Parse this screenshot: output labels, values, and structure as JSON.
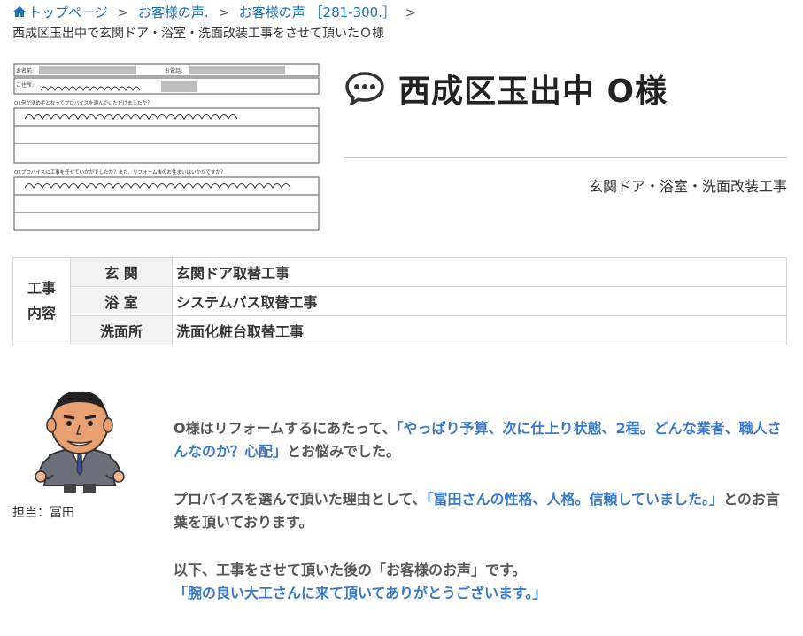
{
  "breadcrumb": {
    "items": [
      {
        "label": "トップページ",
        "icon": "home-icon"
      },
      {
        "label": "お客様の声."
      },
      {
        "label": "お客様の声 ［281-300.］"
      }
    ],
    "separator": ">",
    "current": "西成区玉出中で玄関ドア・浴室・洗面改装工事をさせて頂いたＯ様"
  },
  "title": {
    "icon": "chat-bubble-icon",
    "text": "西成区玉出中 O様"
  },
  "subtitle": "玄関ドア・浴室・洗面改装工事",
  "work_table": {
    "header": [
      "工事",
      "内容"
    ],
    "rows": [
      {
        "category": "玄 関",
        "detail": "玄関ドア取替工事"
      },
      {
        "category": "浴 室",
        "detail": "システムバス取替工事"
      },
      {
        "category": "洗面所",
        "detail": "洗面化粧台取替工事"
      }
    ]
  },
  "staff": {
    "label": "担当：冨田"
  },
  "comment": {
    "p1_pre": "O様はリフォームするにあたって、",
    "p1_hl": "「やっぱり予算、次に仕上り状態、2程。どんな業者、職人さんなのか？心配」",
    "p1_post": "とお悩みでした。",
    "p2_pre": "プロバイスを選んで頂いた理由として、",
    "p2_hl": "「冨田さんの性格、人格。信頼していました。」",
    "p2_post": "とのお言葉を頂いております。",
    "p3_line": "以下、工事をさせて頂いた後の「お客様のお声」です。",
    "p3_hl": "「腕の良い大工さんに来て頂いてありがとうございます。」"
  },
  "colors": {
    "link": "#1a6fb5",
    "highlight": "#3a78c9",
    "table_border": "#d7d7d7",
    "table_cat_bg": "#f3f3f3"
  }
}
